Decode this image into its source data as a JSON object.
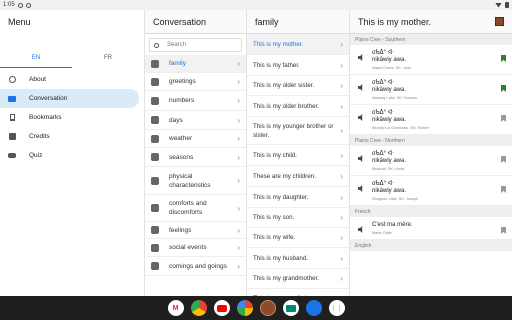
{
  "status": {
    "time": "1:05"
  },
  "menu": {
    "title": "Menu",
    "lang_tabs": [
      "EN",
      "FR"
    ],
    "items": [
      {
        "label": "About",
        "icon": "info-icon"
      },
      {
        "label": "Conversation",
        "icon": "chat-icon"
      },
      {
        "label": "Bookmarks",
        "icon": "bookmark-icon"
      },
      {
        "label": "Credits",
        "icon": "credits-icon"
      },
      {
        "label": "Quiz",
        "icon": "gamepad-icon"
      }
    ]
  },
  "categories": {
    "title": "Conversation",
    "search_placeholder": "Search",
    "items": [
      {
        "label": "family",
        "icon": "family-icon"
      },
      {
        "label": "greetings",
        "icon": "greetings-icon"
      },
      {
        "label": "numbers",
        "icon": "numbers-icon"
      },
      {
        "label": "days",
        "icon": "calendar-icon"
      },
      {
        "label": "weather",
        "icon": "weather-icon"
      },
      {
        "label": "seasons",
        "icon": "snowflake-icon"
      },
      {
        "label": "physical characteristics",
        "icon": "person-icon"
      },
      {
        "label": "comforts and discomforts",
        "icon": "comforts-icon"
      },
      {
        "label": "feelings",
        "icon": "heart-icon"
      },
      {
        "label": "social events",
        "icon": "group-icon"
      },
      {
        "label": "comings and goings",
        "icon": "walk-icon"
      }
    ]
  },
  "phrases": {
    "title": "family",
    "items": [
      "This is my mother.",
      "This is my father.",
      "This is my older sister.",
      "This is my older brother.",
      "This is my younger brother or sister.",
      "This is my child.",
      "These are my children.",
      "This is my daughter.",
      "This is my son.",
      "This is my wife.",
      "This is my husband.",
      "This is my grandmother.",
      "This is my grandfather."
    ]
  },
  "detail": {
    "title": "This is my mother.",
    "sections": [
      {
        "name": "Plains Cree - Southern",
        "entries": [
          {
            "syllabics": "σᑲᐃᐢ ᐊᐧ",
            "text": "nikâwiy awa.",
            "speaker": "Maple Creek, SK: Joan",
            "bookmarked": true
          },
          {
            "syllabics": "σᑲᐃᐢ ᐊᐧ",
            "text": "nikâwiy awa.",
            "speaker": "Maskeg Lake, SK: Dolores",
            "bookmarked": true
          },
          {
            "syllabics": "σᑲᐃᐢ ᐊᐧ",
            "text": "nikâwiy awa.",
            "speaker": "Beardy's & Okemasis, SK: Robert",
            "bookmarked": false
          }
        ]
      },
      {
        "name": "Plains Cree - Northern",
        "entries": [
          {
            "syllabics": "σᑲᐃᐢ ᐊᐧ",
            "text": "nikâwiy awa.",
            "speaker": "Beauval, SK: Linda",
            "bookmarked": false
          },
          {
            "syllabics": "σᑲᐃᐢ ᐊᐧ",
            "text": "nikâwiy awa.",
            "speaker": "Sturgeon Lake, SK: Joseph",
            "bookmarked": false
          }
        ]
      },
      {
        "name": "French",
        "entries": [
          {
            "syllabics": "",
            "text": "C'est ma mère.",
            "speaker": "Marie-Odile",
            "bookmarked": false
          }
        ]
      },
      {
        "name": "English",
        "entries": []
      }
    ]
  },
  "taskbar": {
    "apps": [
      "gmail-icon",
      "chrome-icon",
      "youtube-icon",
      "photos-icon",
      "app-icon",
      "meet-icon",
      "files-icon",
      "app-drawer-icon"
    ]
  },
  "colors": {
    "accent": "#1a73e8",
    "active_bg": "#dbeaf7",
    "bookmark_on": "#2e7d32"
  }
}
